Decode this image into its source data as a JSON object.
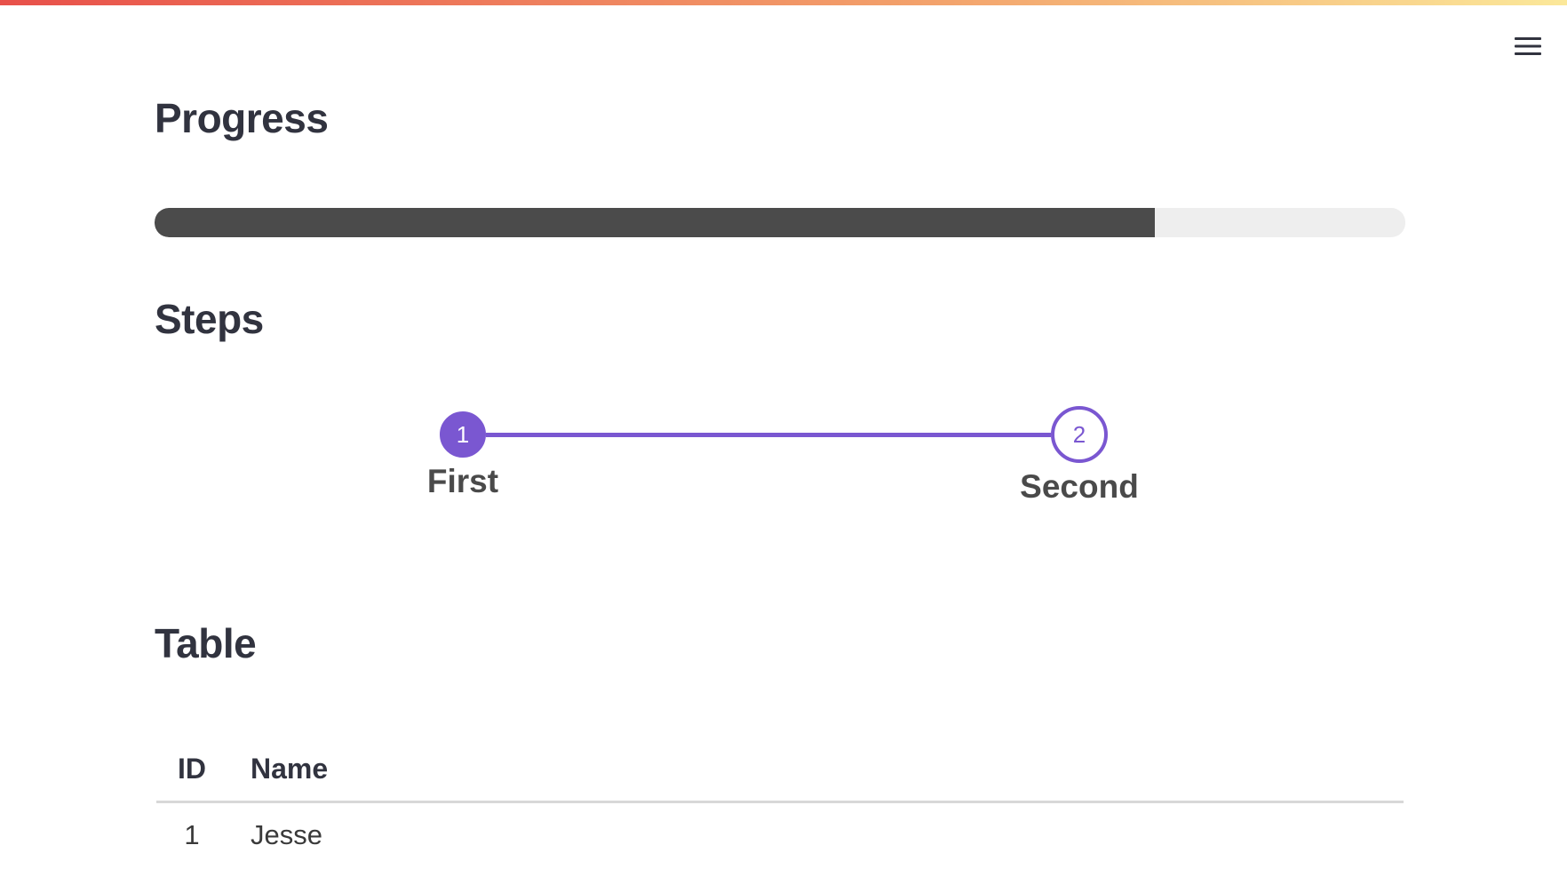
{
  "colors": {
    "accent": "#7a57d1",
    "progress_fill": "#4b4b4b",
    "progress_track": "#eeeeee",
    "text": "#31333f"
  },
  "header": {
    "menu_icon": "hamburger-menu-icon"
  },
  "progress": {
    "title": "Progress",
    "value": 0.8
  },
  "steps": {
    "title": "Steps",
    "items": [
      {
        "number": "1",
        "label": "First",
        "state": "done"
      },
      {
        "number": "2",
        "label": "Second",
        "state": "current"
      }
    ]
  },
  "table": {
    "title": "Table",
    "columns": [
      "ID",
      "Name"
    ],
    "rows": [
      [
        "1",
        "Jesse"
      ]
    ]
  }
}
